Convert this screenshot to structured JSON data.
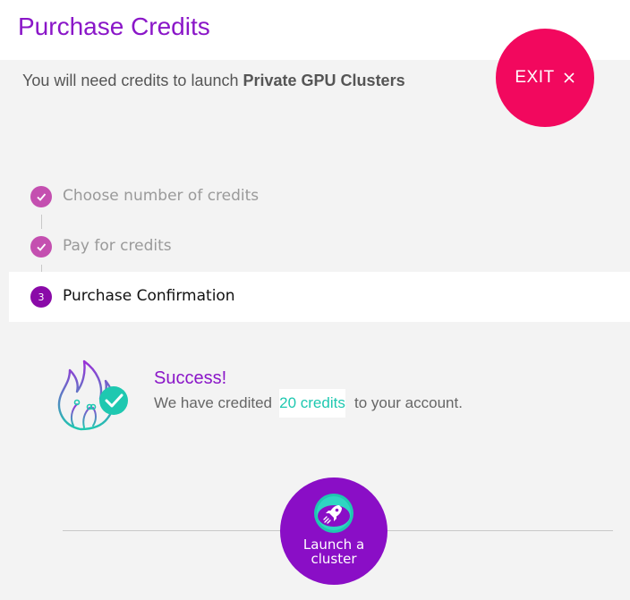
{
  "header": {
    "title": "Purchase Credits"
  },
  "notice": {
    "prefix": "You will need credits to launch",
    "product": "Private GPU Clusters"
  },
  "exit_button": {
    "label": "EXIT",
    "icon": "close-icon"
  },
  "stepper": {
    "steps": [
      {
        "label": "Choose number of credits",
        "status": "done",
        "marker": "check-icon"
      },
      {
        "label": "Pay for credits",
        "status": "done",
        "marker": "check-icon"
      },
      {
        "label": "Purchase Confirmation",
        "status": "current",
        "number": "3"
      }
    ]
  },
  "success": {
    "icon": "flame-check-icon",
    "title": "Success!",
    "message_prefix": "We have credited",
    "credits": "20 credits",
    "message_suffix": "to your account."
  },
  "launch_button": {
    "icon": "rocket-icon",
    "line1": "Launch a",
    "line2": "cluster"
  },
  "colors": {
    "brand_purple": "#8a16c8",
    "exit_pink": "#f2085e",
    "step_done": "#c44fb0",
    "step_current": "#8a0aa8",
    "accent_teal": "#1ec8b0",
    "background": "#f3f3f3"
  }
}
